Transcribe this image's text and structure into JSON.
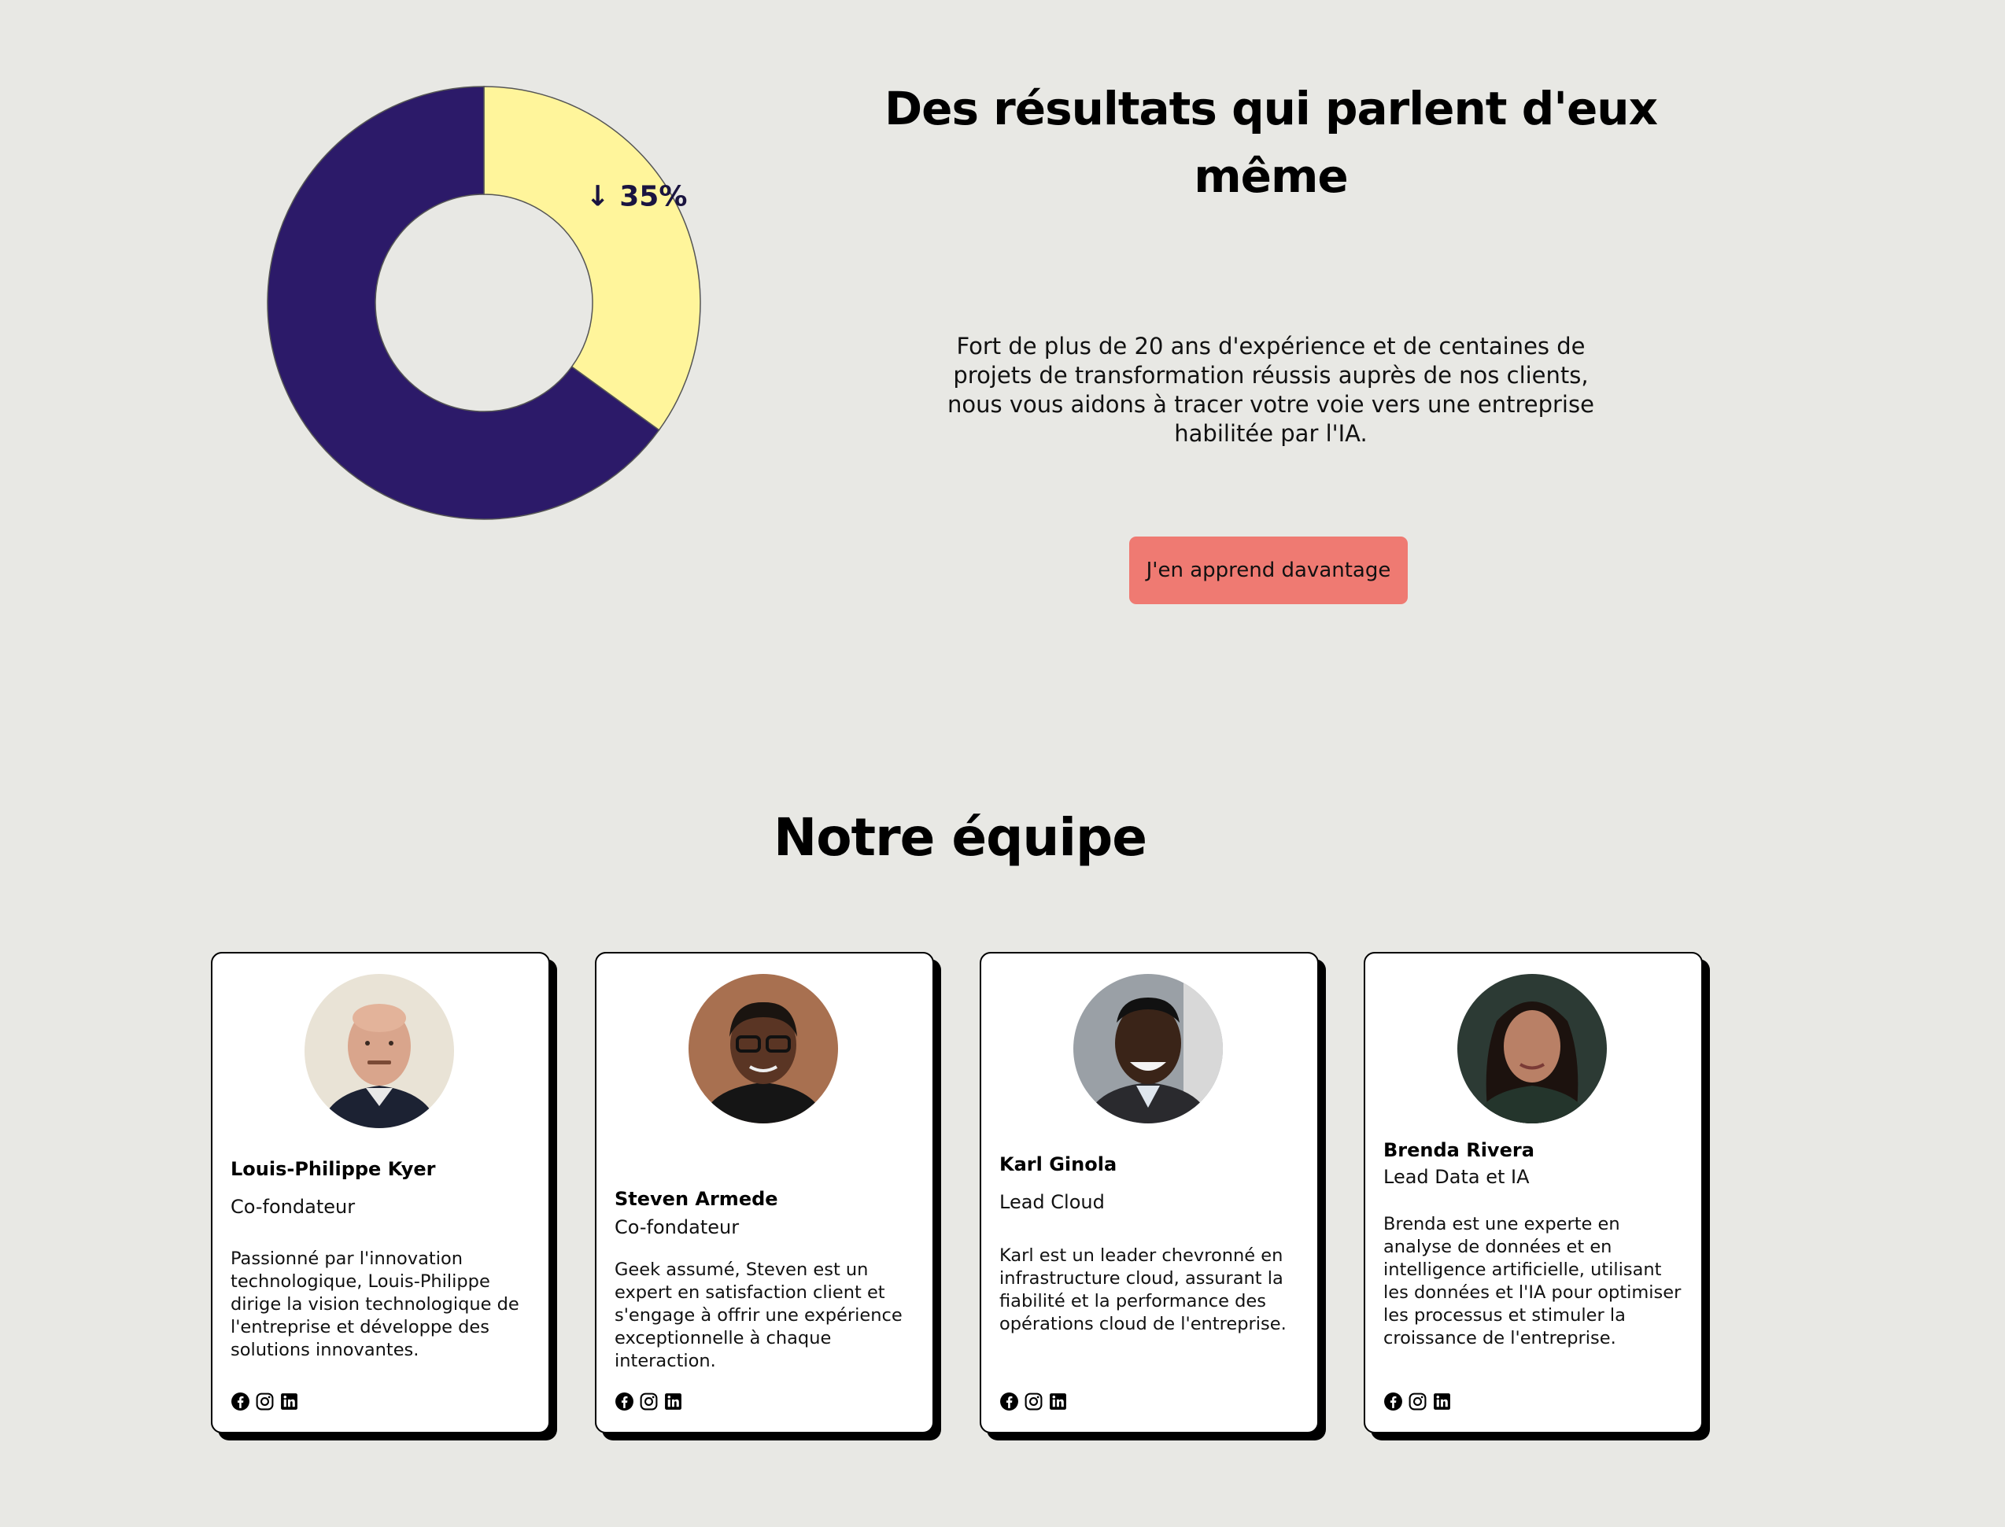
{
  "results": {
    "title": "Des résultats qui parlent d'eux même",
    "description": "Fort de plus de 20 ans d'expérience et de centaines de projets de transformation réussis auprès de nos clients, nous vous aidons à tracer votre voie vers une entreprise habilitée par l'IA.",
    "cta_label": "J'en apprend davantage"
  },
  "chart_data": {
    "type": "pie",
    "title": "",
    "slices": [
      {
        "label": "↓ 35%",
        "value": 35,
        "color": "#fff59b"
      },
      {
        "label": "",
        "value": 65,
        "color": "#2c1a69"
      }
    ],
    "donut": true
  },
  "team": {
    "title": "Notre équipe",
    "members": [
      {
        "name": "Louis-Philippe Kyer",
        "role": "Co-fondateur",
        "bio": "Passionné par l'innovation technologique, Louis-Philippe dirige la vision technologique de l'entreprise et développe des solutions innovantes."
      },
      {
        "name": "Steven Armede",
        "role": "Co-fondateur",
        "bio": "Geek assumé, Steven est un expert en satisfaction client et s'engage à offrir une expérience exceptionnelle à chaque interaction."
      },
      {
        "name": "Karl Ginola",
        "role": "Lead Cloud",
        "bio": "Karl est un leader chevronné en infrastructure cloud, assurant la fiabilité et la performance des opérations cloud de l'entreprise."
      },
      {
        "name": "Brenda Rivera",
        "role": "Lead Data et IA",
        "bio": "Brenda est une experte en analyse de données et en intelligence artificielle, utilisant les données et l'IA pour optimiser les processus et stimuler la croissance de l'entreprise."
      }
    ],
    "social_icons": [
      "facebook-icon",
      "instagram-icon",
      "linkedin-icon"
    ]
  },
  "colors": {
    "background": "#e8e8e4",
    "accent": "#ef7a72",
    "donut_dark": "#2c1a69",
    "donut_light": "#fff59b"
  }
}
